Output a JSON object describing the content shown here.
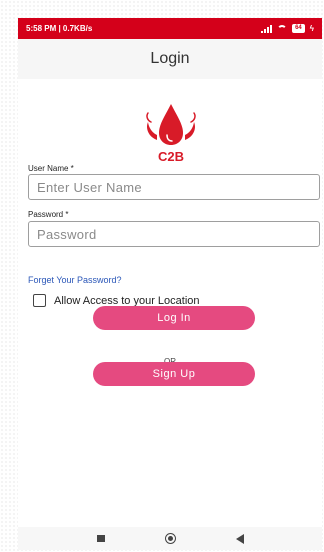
{
  "status_bar": {
    "time_speed": "5:58 PM | 0.7KB/s",
    "battery": "64"
  },
  "header": {
    "title": "Login"
  },
  "logo": {
    "text": "C2B"
  },
  "form": {
    "username_label": "User Name *",
    "username_placeholder": "Enter User Name",
    "password_label": "Password *",
    "password_placeholder": "Password",
    "forgot_link": "Forget Your Password?",
    "location_checkbox_label": "Allow Access to your Location",
    "location_checked": false
  },
  "actions": {
    "login_label": "Log In",
    "or_label": "OR",
    "signup_label": "Sign Up"
  },
  "colors": {
    "status_bar": "#d4001a",
    "button": "#e54a80",
    "link": "#2b57b8"
  },
  "icons": [
    "signal-icon",
    "wifi-icon",
    "battery-icon",
    "charging-icon",
    "recent-apps-icon",
    "home-icon",
    "back-icon"
  ]
}
